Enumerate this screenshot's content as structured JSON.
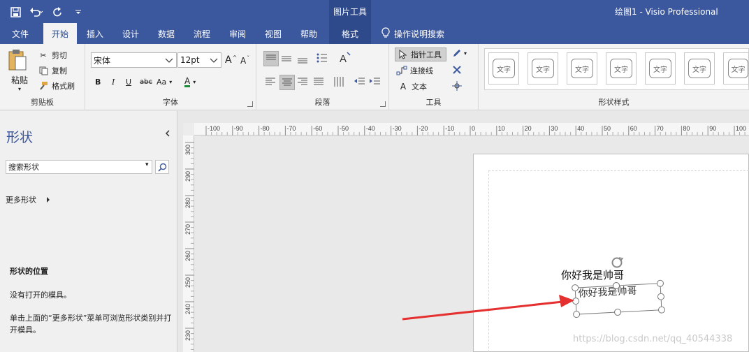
{
  "title_bar": {
    "context_tab_group": "图片工具",
    "document_title": "绘图1  -  Visio Professional"
  },
  "tabs": [
    "文件",
    "开始",
    "插入",
    "设计",
    "数据",
    "流程",
    "审阅",
    "视图",
    "帮助",
    "格式"
  ],
  "tell_me": "操作说明搜索",
  "ribbon": {
    "clipboard": {
      "paste": "粘贴",
      "cut": "剪切",
      "copy": "复制",
      "format_painter": "格式刷",
      "label": "剪贴板"
    },
    "font": {
      "font_name": "宋体",
      "font_size": "12pt",
      "grow": "A",
      "shrink": "A",
      "bold": "B",
      "italic": "I",
      "underline": "U",
      "strike": "abc",
      "case": "Aa",
      "color": "A",
      "label": "字体"
    },
    "paragraph": {
      "label": "段落"
    },
    "tools": {
      "pointer": "指针工具",
      "connector": "连接线",
      "text": "文本",
      "text_icon": "A",
      "label": "工具"
    },
    "shape_styles": {
      "thumb_text": "文字",
      "label": "形状样式"
    }
  },
  "shapes_pane": {
    "title": "形状",
    "search_placeholder": "搜索形状",
    "more_shapes": "更多形状",
    "position_title": "形状的位置",
    "no_stencils": "没有打开的模具。",
    "hint": "单击上面的“更多形状”菜单可浏览形状类别并打开模具。"
  },
  "rulers": {
    "horizontal": [
      "-100",
      "-90",
      "-80",
      "-70",
      "-60",
      "-50",
      "-40",
      "-30",
      "-20",
      "-10",
      "0",
      "10",
      "20",
      "30",
      "40",
      "50",
      "60",
      "70",
      "80",
      "90",
      "100"
    ],
    "vertical": [
      "300",
      "290",
      "280",
      "270",
      "260",
      "250",
      "240",
      "230"
    ]
  },
  "canvas": {
    "text_shape": "你好我是帅哥",
    "selected_text": "你好我是帅哥"
  },
  "watermark": "https://blog.csdn.net/qq_40544338",
  "colors": {
    "title_bar": "#3b579d",
    "context_tab": "#2e4a8a",
    "ribbon": "#f3f3f3",
    "accent": "#3b579d",
    "arrow": "#e53030"
  }
}
